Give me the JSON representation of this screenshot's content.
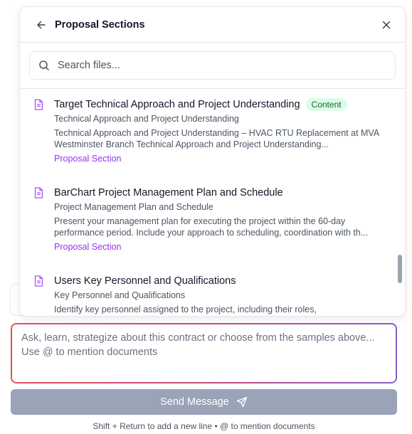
{
  "popup": {
    "title": "Proposal Sections",
    "search_placeholder": "Search files...",
    "items": [
      {
        "title": "Target Technical Approach and Project Understanding",
        "badge": "Content",
        "subtitle": "Technical Approach and Project Understanding",
        "description": "Technical Approach and Project Understanding – HVAC RTU Replacement at MVA Westminster Branch Technical Approach and Project Understanding...",
        "tag": "Proposal Section",
        "icon": "document-icon"
      },
      {
        "title": "BarChart Project Management Plan and Schedule",
        "badge": "",
        "subtitle": "Project Management Plan and Schedule",
        "description": "Present your management plan for executing the project within the 60-day performance period. Include your approach to scheduling, coordination with th...",
        "tag": "Proposal Section",
        "icon": "document-icon"
      },
      {
        "title": "Users Key Personnel and Qualifications",
        "badge": "",
        "subtitle": "Key Personnel and Qualifications",
        "description": "Identify key personnel assigned to the project, including their roles,",
        "tag": "",
        "icon": "document-icon"
      }
    ]
  },
  "composer": {
    "placeholder": "Ask, learn, strategize about this contract or choose from the samples above... Use @ to mention documents",
    "send_label": "Send Message",
    "hint": "Shift + Return to add a new line • @ to mention documents"
  },
  "colors": {
    "accent_purple": "#9333ea",
    "badge_bg": "#dcfce7",
    "badge_text": "#166534",
    "send_button": "#9ba3b8"
  }
}
